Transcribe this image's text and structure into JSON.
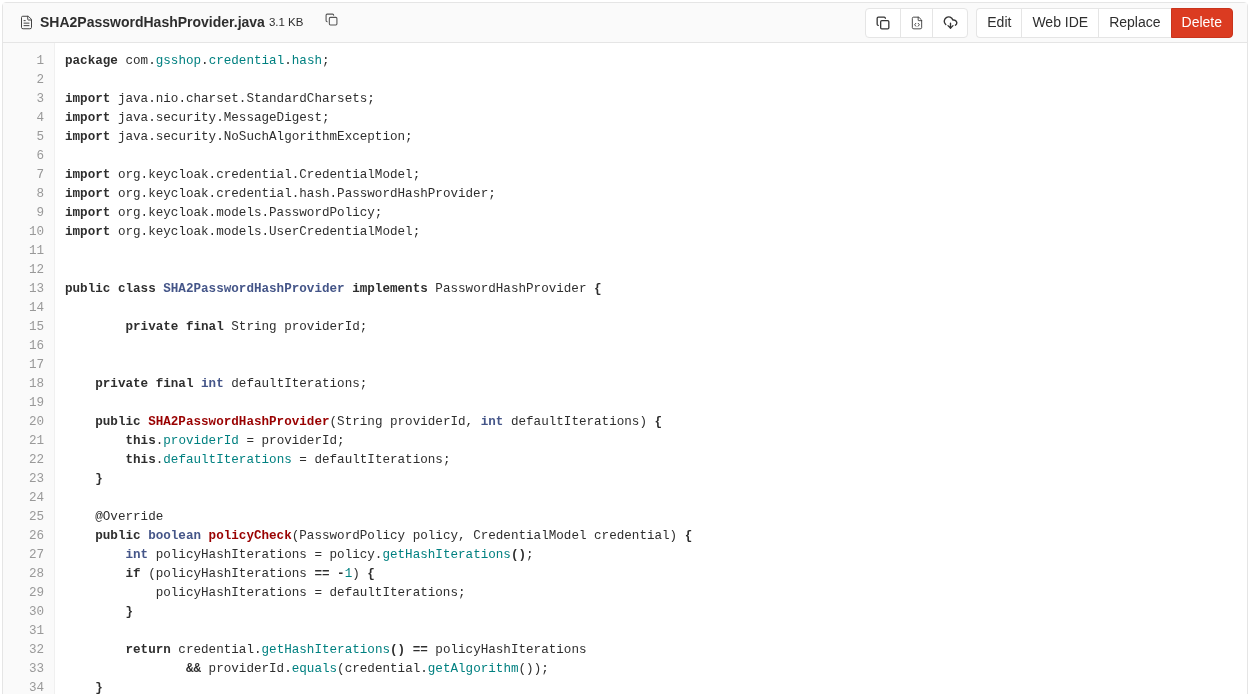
{
  "file": {
    "name": "SHA2PasswordHashProvider.java",
    "size": "3.1 KB"
  },
  "buttons": [
    {
      "label": "Edit",
      "kind": "default"
    },
    {
      "label": "Web IDE",
      "kind": "default"
    },
    {
      "label": "Replace",
      "kind": "default"
    },
    {
      "label": "Delete",
      "kind": "danger"
    }
  ],
  "code_lines": [
    {
      "number": "1",
      "tokens": [
        {
          "text": "package",
          "kind": "kw"
        },
        {
          "text": " com.",
          "kind": "plain"
        },
        {
          "text": "gsshop",
          "kind": "prop"
        },
        {
          "text": ".",
          "kind": "plain"
        },
        {
          "text": "credential",
          "kind": "prop"
        },
        {
          "text": ".",
          "kind": "plain"
        },
        {
          "text": "hash",
          "kind": "prop"
        },
        {
          "text": ";",
          "kind": "plain"
        }
      ]
    },
    {
      "number": "2"
    },
    {
      "number": "3",
      "tokens": [
        {
          "text": "import",
          "kind": "kw"
        },
        {
          "text": " java.nio.charset.StandardCharsets;",
          "kind": "plain"
        }
      ]
    },
    {
      "number": "4",
      "tokens": [
        {
          "text": "import",
          "kind": "kw"
        },
        {
          "text": " java.security.MessageDigest;",
          "kind": "plain"
        }
      ]
    },
    {
      "number": "5",
      "tokens": [
        {
          "text": "import",
          "kind": "kw"
        },
        {
          "text": " java.security.NoSuchAlgorithmException;",
          "kind": "plain"
        }
      ]
    },
    {
      "number": "6"
    },
    {
      "number": "7",
      "tokens": [
        {
          "text": "import",
          "kind": "kw"
        },
        {
          "text": " org.keycloak.credential.CredentialModel;",
          "kind": "plain"
        }
      ]
    },
    {
      "number": "8",
      "tokens": [
        {
          "text": "import",
          "kind": "kw"
        },
        {
          "text": " org.keycloak.credential.hash.PasswordHashProvider;",
          "kind": "plain"
        }
      ]
    },
    {
      "number": "9",
      "tokens": [
        {
          "text": "import",
          "kind": "kw"
        },
        {
          "text": " org.keycloak.models.PasswordPolicy;",
          "kind": "plain"
        }
      ]
    },
    {
      "number": "10",
      "tokens": [
        {
          "text": "import",
          "kind": "kw"
        },
        {
          "text": " org.keycloak.models.UserCredentialModel;",
          "kind": "plain"
        }
      ]
    },
    {
      "number": "11"
    },
    {
      "number": "12"
    },
    {
      "number": "13",
      "tokens": [
        {
          "text": "public class ",
          "kind": "kw"
        },
        {
          "text": "SHA2PasswordHashProvider",
          "kind": "type"
        },
        {
          "text": " implements",
          "kind": "kw"
        },
        {
          "text": " PasswordHashProvider ",
          "kind": "plain"
        },
        {
          "text": "{",
          "kind": "kw"
        }
      ]
    },
    {
      "number": "14"
    },
    {
      "number": "15",
      "tokens": [
        {
          "text": "        private final",
          "kind": "kw"
        },
        {
          "text": " String providerId;",
          "kind": "plain"
        }
      ]
    },
    {
      "number": "16"
    },
    {
      "number": "17"
    },
    {
      "number": "18",
      "tokens": [
        {
          "text": "    private final ",
          "kind": "kw"
        },
        {
          "text": "int",
          "kind": "type"
        },
        {
          "text": " defaultIterations;",
          "kind": "plain"
        }
      ]
    },
    {
      "number": "19"
    },
    {
      "number": "20",
      "tokens": [
        {
          "text": "    public ",
          "kind": "kw"
        },
        {
          "text": "SHA2PasswordHashProvider",
          "kind": "fn"
        },
        {
          "text": "(String providerId, ",
          "kind": "plain"
        },
        {
          "text": "int",
          "kind": "type"
        },
        {
          "text": " defaultIterations) ",
          "kind": "plain"
        },
        {
          "text": "{",
          "kind": "kw"
        }
      ]
    },
    {
      "number": "21",
      "tokens": [
        {
          "text": "        this",
          "kind": "kw"
        },
        {
          "text": ".",
          "kind": "plain"
        },
        {
          "text": "providerId",
          "kind": "prop"
        },
        {
          "text": " = providerId;",
          "kind": "plain"
        }
      ]
    },
    {
      "number": "22",
      "tokens": [
        {
          "text": "        this",
          "kind": "kw"
        },
        {
          "text": ".",
          "kind": "plain"
        },
        {
          "text": "defaultIterations",
          "kind": "prop"
        },
        {
          "text": " = defaultIterations;",
          "kind": "plain"
        }
      ]
    },
    {
      "number": "23",
      "tokens": [
        {
          "text": "    }",
          "kind": "kw"
        }
      ]
    },
    {
      "number": "24"
    },
    {
      "number": "25",
      "tokens": [
        {
          "text": "    @Override",
          "kind": "plain"
        }
      ]
    },
    {
      "number": "26",
      "tokens": [
        {
          "text": "    public ",
          "kind": "kw"
        },
        {
          "text": "boolean",
          "kind": "type"
        },
        {
          "text": " policyCheck",
          "kind": "fn"
        },
        {
          "text": "(PasswordPolicy policy, CredentialModel credential) ",
          "kind": "plain"
        },
        {
          "text": "{",
          "kind": "kw"
        }
      ]
    },
    {
      "number": "27",
      "tokens": [
        {
          "text": "        int",
          "kind": "type"
        },
        {
          "text": " policyHashIterations = policy.",
          "kind": "plain"
        },
        {
          "text": "getHashIterations",
          "kind": "prop"
        },
        {
          "text": "()",
          "kind": "kw"
        },
        {
          "text": ";",
          "kind": "plain"
        }
      ]
    },
    {
      "number": "28",
      "tokens": [
        {
          "text": "        if",
          "kind": "kw"
        },
        {
          "text": " (policyHashIterations ",
          "kind": "plain"
        },
        {
          "text": "== -",
          "kind": "kw"
        },
        {
          "text": "1",
          "kind": "prop"
        },
        {
          "text": ") ",
          "kind": "plain"
        },
        {
          "text": "{",
          "kind": "kw"
        }
      ]
    },
    {
      "number": "29",
      "tokens": [
        {
          "text": "            policyHashIterations = defaultIterations;",
          "kind": "plain"
        }
      ]
    },
    {
      "number": "30",
      "tokens": [
        {
          "text": "        }",
          "kind": "kw"
        }
      ]
    },
    {
      "number": "31"
    },
    {
      "number": "32",
      "tokens": [
        {
          "text": "        return",
          "kind": "kw"
        },
        {
          "text": " credential.",
          "kind": "plain"
        },
        {
          "text": "getHashIterations",
          "kind": "prop"
        },
        {
          "text": "() ==",
          "kind": "kw"
        },
        {
          "text": " policyHashIterations",
          "kind": "plain"
        }
      ]
    },
    {
      "number": "33",
      "tokens": [
        {
          "text": "                &&",
          "kind": "kw"
        },
        {
          "text": " providerId.",
          "kind": "plain"
        },
        {
          "text": "equals",
          "kind": "prop"
        },
        {
          "text": "(credential.",
          "kind": "plain"
        },
        {
          "text": "getAlgorithm",
          "kind": "prop"
        },
        {
          "text": "());",
          "kind": "plain"
        }
      ]
    },
    {
      "number": "34",
      "tokens": [
        {
          "text": "    }",
          "kind": "kw"
        }
      ]
    }
  ]
}
